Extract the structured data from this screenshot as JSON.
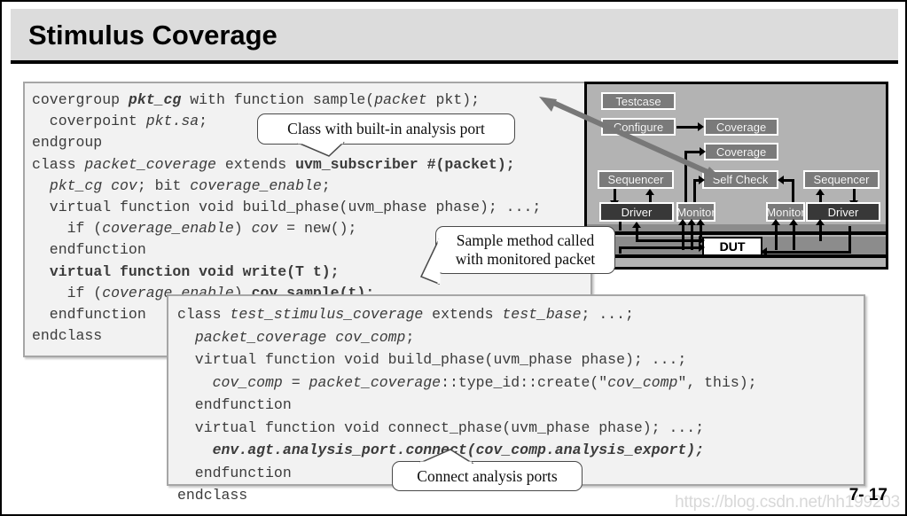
{
  "slide": {
    "title": "Stimulus Coverage",
    "page_number": "7- 17",
    "watermark": "https://blog.csdn.net/hh199203"
  },
  "code_top": {
    "lines": [
      "covergroup pkt_cg with function sample(packet pkt);",
      "  coverpoint pkt.sa;",
      "endgroup",
      "class packet_coverage extends uvm_subscriber #(packet);",
      "  pkt_cg cov; bit coverage_enable;",
      "  virtual function void build_phase(uvm_phase phase); ...;",
      "    if (coverage_enable) cov = new();",
      "  endfunction",
      "  virtual function void write(T t);",
      "    if (coverage_enable) cov.sample(t);",
      "  endfunction",
      "endclass"
    ]
  },
  "code_bottom": {
    "lines": [
      "class test_stimulus_coverage extends test_base; ...;",
      "  packet_coverage cov_comp;",
      "  virtual function void build_phase(uvm_phase phase); ...;",
      "    cov_comp = packet_coverage::type_id::create(\"cov_comp\", this);",
      "  endfunction",
      "  virtual function void connect_phase(uvm_phase phase); ...;",
      "    env.agt.analysis_port.connect(cov_comp.analysis_export);",
      "  endfunction",
      "endclass"
    ]
  },
  "callouts": [
    {
      "id": "analysis-port",
      "text": "Class with built-in analysis port"
    },
    {
      "id": "sample-method",
      "text": "Sample method called\nwith monitored packet"
    },
    {
      "id": "connect-ports",
      "text": "Connect analysis ports"
    }
  ],
  "callout_text": {
    "analysis_port": "Class with built-in analysis port",
    "sample_method_line1": "Sample method called",
    "sample_method_line2": "with monitored packet",
    "connect_ports": "Connect analysis ports"
  },
  "diagram": {
    "name": "uvm-testbench-diagram",
    "boxes": [
      {
        "name": "testcase",
        "label": "Testcase",
        "style": "gray"
      },
      {
        "name": "configure",
        "label": "Configure",
        "style": "gray"
      },
      {
        "name": "coverage-top",
        "label": "Coverage",
        "style": "gray"
      },
      {
        "name": "coverage-mid",
        "label": "Coverage",
        "style": "gray"
      },
      {
        "name": "sequencer-left",
        "label": "Sequencer",
        "style": "gray"
      },
      {
        "name": "self-check",
        "label": "Self Check",
        "style": "gray"
      },
      {
        "name": "sequencer-right",
        "label": "Sequencer",
        "style": "gray"
      },
      {
        "name": "driver-left",
        "label": "Driver",
        "style": "dark"
      },
      {
        "name": "monitor-left",
        "label": "Monitor",
        "style": "gray"
      },
      {
        "name": "monitor-right",
        "label": "Monitor",
        "style": "gray"
      },
      {
        "name": "driver-right",
        "label": "Driver",
        "style": "dark"
      },
      {
        "name": "dut",
        "label": "DUT",
        "style": "white"
      }
    ],
    "labels": {
      "testcase": "Testcase",
      "configure": "Configure",
      "coverage_top": "Coverage",
      "coverage_mid": "Coverage",
      "sequencer_left": "Sequencer",
      "self_check": "Self Check",
      "sequencer_right": "Sequencer",
      "driver_left": "Driver",
      "monitor_left": "Monitor",
      "monitor_right": "Monitor",
      "driver_right": "Driver",
      "dut": "DUT"
    }
  },
  "colors": {
    "title_bar": "#dcdcdc",
    "code_bg": "#f2f2f2",
    "code_border": "#a6a6a6",
    "diagram_bg": "#b3b3b3",
    "box_gray": "#7a7a7a",
    "box_dark": "#383838",
    "watermark": "#d8d8d8"
  }
}
